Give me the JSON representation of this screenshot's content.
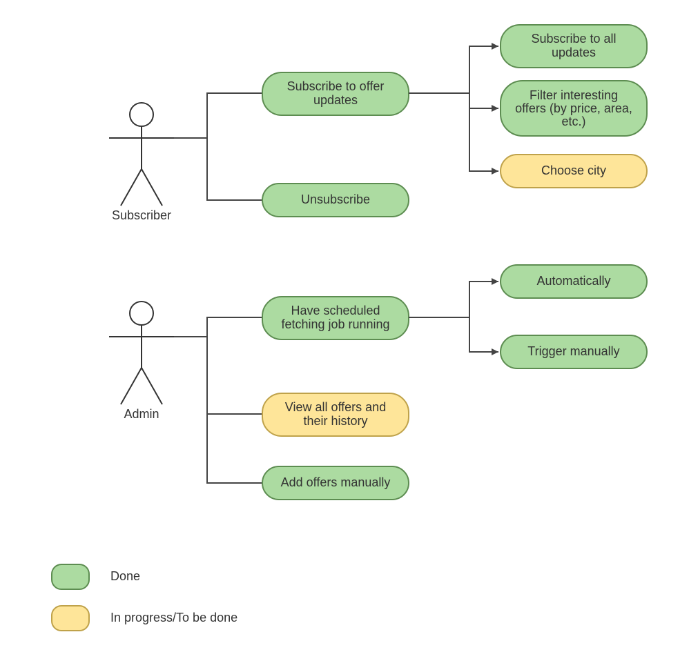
{
  "actors": {
    "subscriber": {
      "label": "Subscriber"
    },
    "admin": {
      "label": "Admin"
    }
  },
  "nodes": {
    "subscribe_offer_updates": {
      "line1": "Subscribe to offer",
      "line2": "updates",
      "status": "done"
    },
    "unsubscribe": {
      "label": "Unsubscribe",
      "status": "done"
    },
    "subscribe_all": {
      "line1": "Subscribe to all",
      "line2": "updates",
      "status": "done"
    },
    "filter_offers": {
      "line1": "Filter interesting",
      "line2": "offers (by price, area,",
      "line3": "etc.)",
      "status": "done"
    },
    "choose_city": {
      "label": "Choose city",
      "status": "todo"
    },
    "scheduled_job": {
      "line1": "Have scheduled",
      "line2": "fetching job running",
      "status": "done"
    },
    "view_offers": {
      "line1": "View all offers and",
      "line2": "their history",
      "status": "todo"
    },
    "add_offers": {
      "label": "Add offers manually",
      "status": "done"
    },
    "automatically": {
      "label": "Automatically",
      "status": "done"
    },
    "trigger_manually": {
      "label": "Trigger manually",
      "status": "done"
    }
  },
  "legend": {
    "done": {
      "label": "Done"
    },
    "todo": {
      "label": "In progress/To be done"
    }
  },
  "colors": {
    "done_fill": "#acdba1",
    "done_stroke": "#5d8d51",
    "todo_fill": "#fee599",
    "todo_stroke": "#bfa24a",
    "actor_stroke": "#333333"
  }
}
